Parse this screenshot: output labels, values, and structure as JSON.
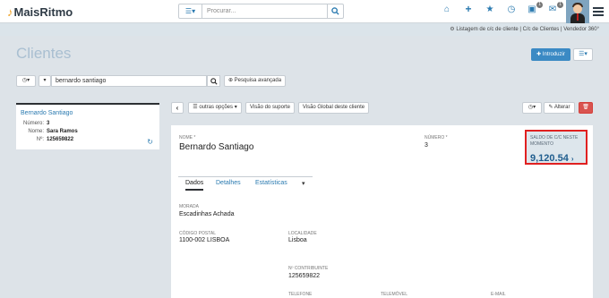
{
  "app": {
    "name": "MaisRitmo"
  },
  "header": {
    "search_placeholder": "Procurar...",
    "badges": {
      "notifications": "1",
      "messages": "1"
    }
  },
  "breadcrumb": [
    "Listagem de c/c de cliente",
    "C/c de Clientes",
    "Vendedor 360°"
  ],
  "breadcrumb_sep": "|",
  "page": {
    "title": "Clientes"
  },
  "toolbar": {
    "introduzir": "Introduzir"
  },
  "search": {
    "value": "bernardo santiago",
    "advanced": "Pesquisa avançada"
  },
  "client_card": {
    "name": "Bernardo Santiago",
    "numero_label": "Número:",
    "numero": "3",
    "nome_label": "Nome:",
    "nome": "Sara Ramos",
    "nif_label": "Nº:",
    "nif": "125659822"
  },
  "actions": {
    "outras_opcoes": "outras opções",
    "visao_suporte": "Visão do suporte",
    "visao_global": "Visão Global deste cliente",
    "alterar": "Alterar"
  },
  "detail": {
    "nome_label": "NOME *",
    "nome": "Bernardo Santiago",
    "numero_label": "NÚMERO *",
    "numero": "3",
    "saldo_label": "SALDO DE C/C NESTE MOMENTO",
    "saldo": "9,120.54",
    "tabs": [
      "Dados",
      "Detalhes",
      "Estatísticas"
    ],
    "morada_label": "MORADA",
    "morada": "Escadinhas Achada",
    "cp_label": "CÓDIGO POSTAL",
    "cp": "1100-002 LISBOA",
    "localidade_label": "LOCALIDADE",
    "localidade": "Lisboa",
    "contribuinte_label": "Nº CONTRIBUINTE",
    "contribuinte": "125659822",
    "telefone_label": "TELEFONE",
    "telemovel_label": "TELEMÓVEL",
    "email_label": "E-MAIL"
  },
  "colors": {
    "accent": "#3b8ac4",
    "danger": "#d9534f",
    "highlight": "#e02020",
    "topbar": "#ffffff"
  }
}
